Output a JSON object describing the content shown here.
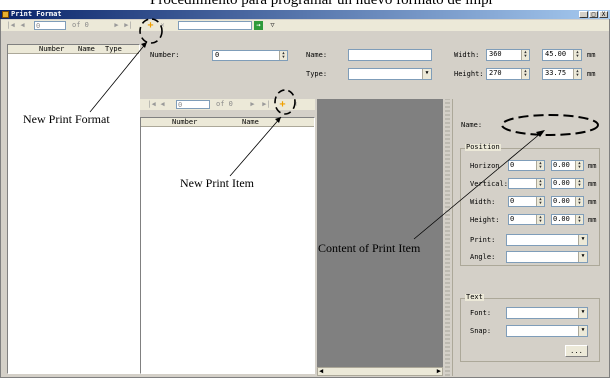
{
  "page_header_fragment": "Procedimiento para programar un nuevo formato de impr",
  "window": {
    "title": "Print Format",
    "minimize": "_",
    "maximize": "□",
    "close": "X"
  },
  "nav": {
    "position": "0",
    "of_label": "of 0",
    "first": "|◀",
    "prev": "◀",
    "next": "▶",
    "last": "▶|",
    "add": "+",
    "delete": "✕",
    "search_value": ""
  },
  "toolbar_icons": {
    "go": "→",
    "filter": "▽"
  },
  "format_list": {
    "columns": [
      "Number",
      "Name",
      "Type"
    ]
  },
  "format_form": {
    "number_label": "Number:",
    "number_value": "0",
    "name_label": "Name:",
    "name_value": "",
    "type_label": "Type:",
    "type_value": "",
    "width_label": "Width:",
    "width_value": "360",
    "width_mm": "45.00",
    "unit": "mm",
    "height_label": "Height:",
    "height_value": "270",
    "height_mm": "33.75"
  },
  "item_nav": {
    "position": "0",
    "of_label": "of 0"
  },
  "item_list": {
    "columns": [
      "Number",
      "Name"
    ]
  },
  "item_props": {
    "name_label": "Name:",
    "position_group": "Position",
    "horizontal_label": "Horizon",
    "horizontal_value": "0",
    "horizontal_mm": "0.00",
    "vertical_label": "Vertical:",
    "vertical_value": "",
    "vertical_mm": "0.00",
    "width_label": "Width:",
    "width_value": "0",
    "width_mm": "0.00",
    "height_label": "Height:",
    "height_value": "0",
    "height_mm": "0.00",
    "unit": "mm",
    "print_label": "Print:",
    "angle_label": "Angle:",
    "text_group": "Text",
    "font_label": "Font:",
    "snap_label": "Snap:",
    "browse_label": "..."
  },
  "annotations": {
    "new_print_format": "New Print Format",
    "new_print_item": "New Print Item",
    "content_of_print_item": "Content of Print Item"
  }
}
